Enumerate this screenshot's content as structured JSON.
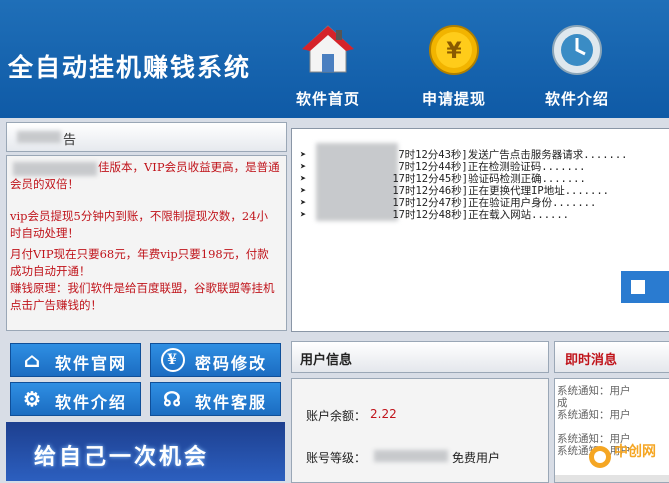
{
  "header": {
    "app_title": "全自动挂机赚钱系统",
    "nav": [
      {
        "label": "软件首页",
        "icon": "house-icon"
      },
      {
        "label": "申请提现",
        "icon": "yuan-coin-icon"
      },
      {
        "label": "软件介绍",
        "icon": "clock-icon"
      }
    ]
  },
  "notice": {
    "title_suffix": "告",
    "paragraphs": [
      "佳版本，VIP会员收益更高，是普通会员的双倍！",
      "vip会员提现5分钟内到账，不限制提现次数，24小时自动处理！",
      "月付VIP现在只要68元，年费vip只要198元，付款成功自动开通！",
      "赚钱原理：我们软件是给百度联盟，谷歌联盟等挂机点击广告赚钱的！"
    ]
  },
  "log": {
    "prefix": "➤",
    "lines": [
      "7时12分43秒]发送广告点击服务器请求.......",
      "7时12分44秒]正在检测验证码.......",
      "17时12分45秒]验证码检测正确.......",
      "17时12分46秒]正在更换代理IP地址.......",
      "17时12分47秒]正在验证用户身份.......",
      "17时12分48秒]正在载入网站......"
    ]
  },
  "buttons": {
    "website": "软件官网",
    "password": "密码修改",
    "intro": "软件介绍",
    "service": "软件客服"
  },
  "banner": {
    "text": "给自己一次机会"
  },
  "user_info": {
    "title": "用户信息",
    "balance_label": "账户余额：",
    "balance_value": "2.22",
    "level_label": "账号等级：",
    "level_value": "免费用户"
  },
  "messages": {
    "title": "即时消息",
    "lines": [
      "系统通知：用户",
      "成",
      "系统通知：用户",
      "",
      "系统通知：用户",
      "系统通知：用户"
    ]
  },
  "watermark": {
    "text": "中创网"
  },
  "colors": {
    "header_blue": "#1565b0",
    "notice_red": "#c0141b",
    "balance_red": "#c0141b"
  }
}
